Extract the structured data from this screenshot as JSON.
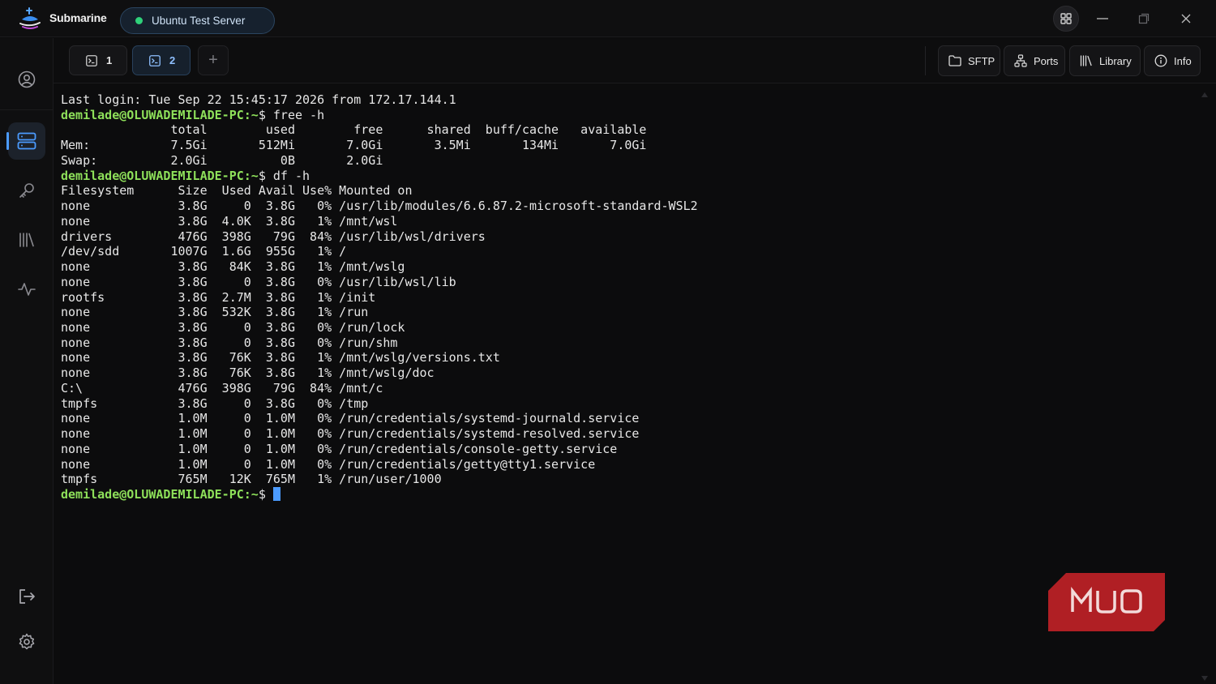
{
  "app": {
    "name": "Submarine"
  },
  "server": {
    "name": "Ubuntu Test Server",
    "status_color": "#2fd17a"
  },
  "sidebar": {
    "items": [
      {
        "name": "profile-icon"
      },
      {
        "name": "servers-icon",
        "active": true
      },
      {
        "name": "key-icon"
      },
      {
        "name": "library-icon"
      },
      {
        "name": "activity-icon"
      },
      {
        "name": "logout-icon"
      },
      {
        "name": "settings-icon"
      }
    ]
  },
  "tabs": [
    {
      "label": "1",
      "active": false
    },
    {
      "label": "2",
      "active": true
    }
  ],
  "toolbar": {
    "sftp": "SFTP",
    "ports": "Ports",
    "library": "Library",
    "info": "Info"
  },
  "terminal": {
    "lines": [
      {
        "text": "Last login: Tue Sep 22 15:45:17 2026 from 172.17.144.1"
      },
      {
        "prompt": "demilade@OLUWADEMILADE-PC",
        "path": "~",
        "cmd": "free -h"
      },
      {
        "text": "               total        used        free      shared  buff/cache   available"
      },
      {
        "text": "Mem:           7.5Gi       512Mi       7.0Gi       3.5Mi       134Mi       7.0Gi"
      },
      {
        "text": "Swap:          2.0Gi          0B       2.0Gi"
      },
      {
        "prompt": "demilade@OLUWADEMILADE-PC",
        "path": "~",
        "cmd": "df -h"
      },
      {
        "text": "Filesystem      Size  Used Avail Use% Mounted on"
      },
      {
        "text": "none            3.8G     0  3.8G   0% /usr/lib/modules/6.6.87.2-microsoft-standard-WSL2"
      },
      {
        "text": "none            3.8G  4.0K  3.8G   1% /mnt/wsl"
      },
      {
        "text": "drivers         476G  398G   79G  84% /usr/lib/wsl/drivers"
      },
      {
        "text": "/dev/sdd       1007G  1.6G  955G   1% /"
      },
      {
        "text": "none            3.8G   84K  3.8G   1% /mnt/wslg"
      },
      {
        "text": "none            3.8G     0  3.8G   0% /usr/lib/wsl/lib"
      },
      {
        "text": "rootfs          3.8G  2.7M  3.8G   1% /init"
      },
      {
        "text": "none            3.8G  532K  3.8G   1% /run"
      },
      {
        "text": "none            3.8G     0  3.8G   0% /run/lock"
      },
      {
        "text": "none            3.8G     0  3.8G   0% /run/shm"
      },
      {
        "text": "none            3.8G   76K  3.8G   1% /mnt/wslg/versions.txt"
      },
      {
        "text": "none            3.8G   76K  3.8G   1% /mnt/wslg/doc"
      },
      {
        "text": "C:\\             476G  398G   79G  84% /mnt/c"
      },
      {
        "text": "tmpfs           3.8G     0  3.8G   0% /tmp"
      },
      {
        "text": "none            1.0M     0  1.0M   0% /run/credentials/systemd-journald.service"
      },
      {
        "text": "none            1.0M     0  1.0M   0% /run/credentials/systemd-resolved.service"
      },
      {
        "text": "none            1.0M     0  1.0M   0% /run/credentials/console-getty.service"
      },
      {
        "text": "none            1.0M     0  1.0M   0% /run/credentials/getty@tty1.service"
      },
      {
        "text": "tmpfs           765M   12K  765M   1% /run/user/1000"
      },
      {
        "prompt": "demilade@OLUWADEMILADE-PC",
        "path": "~",
        "cmd": "",
        "cursor": true
      }
    ]
  },
  "watermark": {
    "text": "MUO"
  },
  "colors": {
    "accent": "#4b9bff",
    "prompt": "#8ee05a",
    "watermark": "#b01f24"
  }
}
